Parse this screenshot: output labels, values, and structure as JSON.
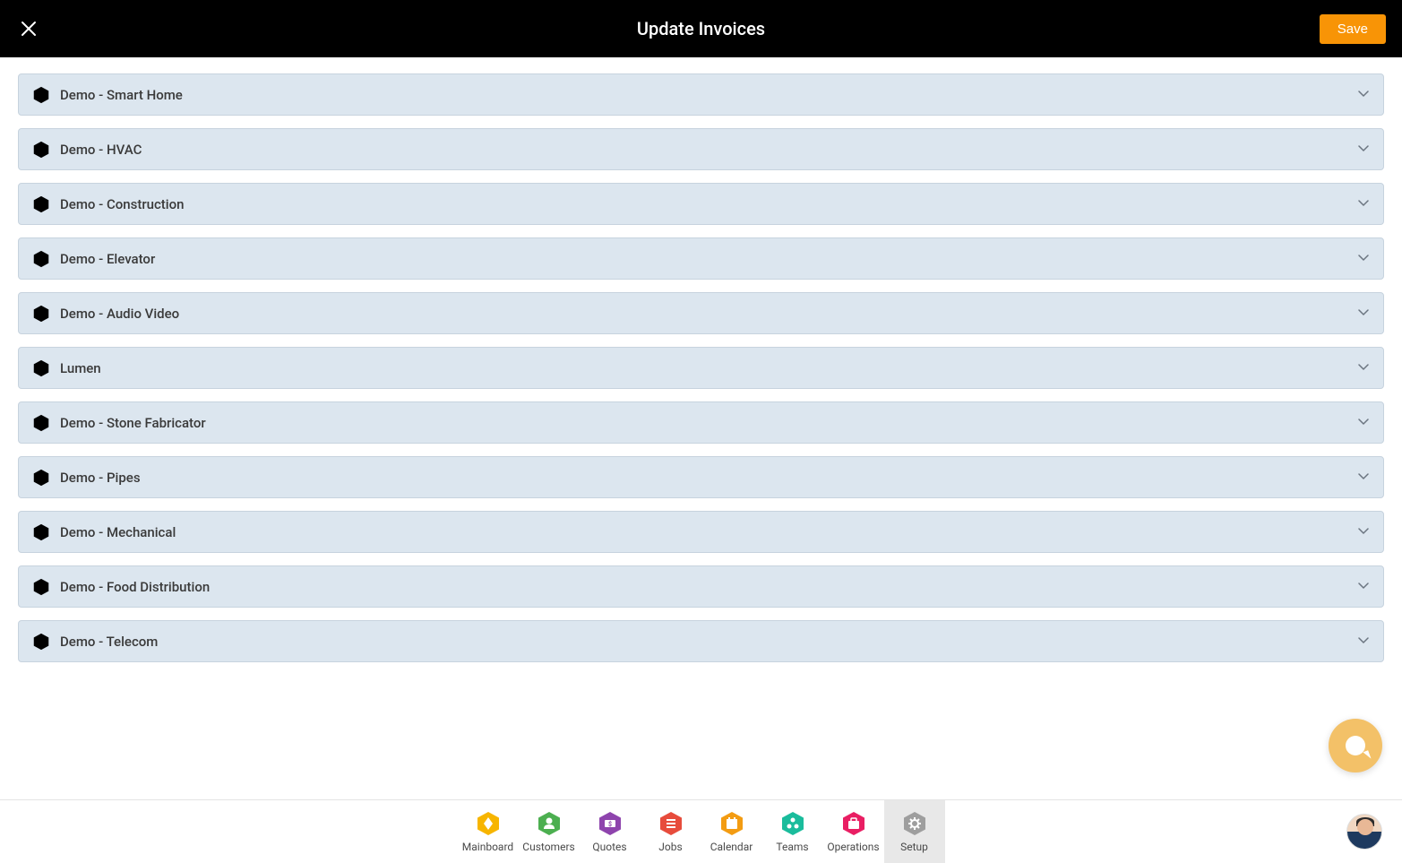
{
  "header": {
    "title": "Update Invoices",
    "save_label": "Save"
  },
  "accordion": {
    "items": [
      {
        "label": "Demo - Smart Home"
      },
      {
        "label": "Demo - HVAC"
      },
      {
        "label": "Demo - Construction"
      },
      {
        "label": "Demo - Elevator"
      },
      {
        "label": "Demo - Audio Video"
      },
      {
        "label": "Lumen"
      },
      {
        "label": "Demo - Stone Fabricator"
      },
      {
        "label": "Demo - Pipes"
      },
      {
        "label": "Demo - Mechanical"
      },
      {
        "label": "Demo - Food Distribution"
      },
      {
        "label": "Demo - Telecom"
      }
    ]
  },
  "nav": {
    "items": [
      {
        "label": "Mainboard",
        "color": "#f7b500",
        "icon": "diamond"
      },
      {
        "label": "Customers",
        "color": "#4caf50",
        "icon": "person"
      },
      {
        "label": "Quotes",
        "color": "#8e44ad",
        "icon": "money"
      },
      {
        "label": "Jobs",
        "color": "#e74c3c",
        "icon": "list"
      },
      {
        "label": "Calendar",
        "color": "#f39c12",
        "icon": "calendar"
      },
      {
        "label": "Teams",
        "color": "#1abc9c",
        "icon": "nodes"
      },
      {
        "label": "Operations",
        "color": "#e91e63",
        "icon": "briefcase"
      },
      {
        "label": "Setup",
        "color": "#9e9e9e",
        "icon": "gear",
        "active": true
      }
    ]
  }
}
